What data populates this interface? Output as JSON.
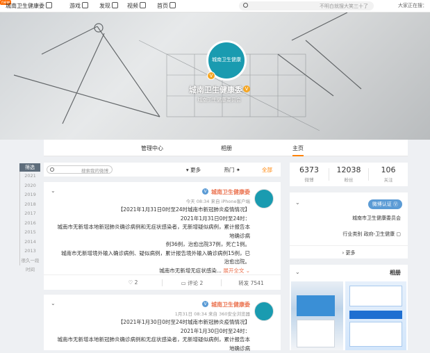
{
  "topbar": {
    "home": "首页",
    "video": "视频",
    "discover": "发现",
    "game": "游戏",
    "user_name": "城南卫生健康委",
    "search_placeholder": "不明白就搜大笑三十了",
    "right_text": "大家正在搜：",
    "badge": "new"
  },
  "cover": {
    "name": "城南卫生健康委",
    "description": "城南卫生健康委员会",
    "avatar_text": "城南卫生健康"
  },
  "tabs": [
    "主页",
    "相册",
    "管理中心"
  ],
  "years": {
    "head": "筛选",
    "items": [
      "2021",
      "2020",
      "2019",
      "2018",
      "2017",
      "2016",
      "2015",
      "2014",
      "2013",
      "很久一段时间"
    ]
  },
  "feed_filter": {
    "all": "全部",
    "hot": "热门",
    "more": "更多",
    "search_placeholder": "搜索我的微博"
  },
  "posts": [
    {
      "name": "城南卫生健康委",
      "meta": "今天 08:34 来自 iPhone客户端",
      "lines": [
        "【2021年1月31日0时至24时城南市新冠肺炎疫情情况】",
        "2021年1月31日0时至24时：",
        "城南市无新增本地新冠肺炎确诊病例和无症状感染者，无新增疑似病例，累计报告本地确诊病",
        "例36例，治愈出院37例，死亡1例。",
        "城南市无新增境外输入确诊病例、疑似病例，累计报告境外输入确诊病例15例，已",
        "治愈出院。",
        "城南市无新增无症状感染..."
      ],
      "more": "展开全文",
      "actions": {
        "share": "转发 7541",
        "comment": "评论 2",
        "like": "2"
      }
    },
    {
      "name": "城南卫生健康委",
      "meta": "1月31日 08:34 来自 360安全浏览器",
      "lines": [
        "【2021年1月30日0时至24时城南市新冠肺炎疫情情况】",
        "2021年1月30日0时至24时：",
        "城南市无新增本地新冠肺炎确诊病例和无症状感染者，无新增疑似病例，累计报告本地确诊病"
      ]
    }
  ],
  "stats": [
    {
      "num": "106",
      "label": "关注"
    },
    {
      "num": "12038",
      "label": "粉丝"
    },
    {
      "num": "6373",
      "label": "微博"
    }
  ],
  "info": {
    "badge": "微博认证",
    "line1": "城南市卫生健康委员会",
    "line2": "行业类别  政府-卫生健康",
    "more": "更多"
  },
  "album": {
    "title": "相册"
  }
}
